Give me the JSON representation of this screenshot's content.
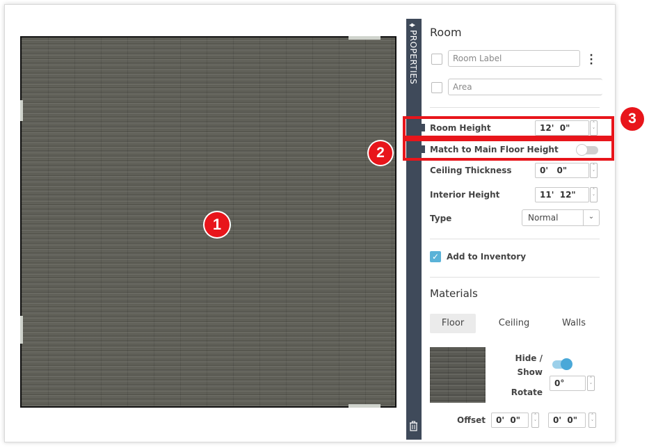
{
  "panel": {
    "section_title": "Room",
    "room_label_placeholder": "Room Label",
    "area_placeholder": "Area",
    "room_height_label": "Room Height",
    "room_height_value": "12'  0\"",
    "match_label": "Match to Main Floor Height",
    "match_toggle": "off",
    "ceiling_thickness_label": "Ceiling Thickness",
    "ceiling_thickness_value": "0'   0\"",
    "interior_height_label": "Interior Height",
    "interior_height_value": "11'  12\"",
    "type_label": "Type",
    "type_value": "Normal",
    "add_inventory_label": "Add to Inventory",
    "add_inventory_checked": true
  },
  "sidebar": {
    "label": "PROPERTIES"
  },
  "materials": {
    "title": "Materials",
    "tabs": [
      "Floor",
      "Ceiling",
      "Walls"
    ],
    "active_tab": "Floor",
    "hide_show_label_1": "Hide /",
    "hide_show_label_2": "Show",
    "hide_show_toggle": "on",
    "rotate_label": "Rotate",
    "rotate_value": "0°",
    "offset_label": "Offset",
    "offset_x": "0'  0\"",
    "offset_y": "0'  0\""
  },
  "annotations": [
    "1",
    "2",
    "3"
  ],
  "colors": {
    "highlight": "#e8151b",
    "accent": "#5ab2d8",
    "sidebar": "#3f4a5a"
  },
  "icons": [
    "collapse-arrows-icon",
    "trash-icon",
    "kebab-menu-icon",
    "spinner-icon",
    "chevron-down-icon",
    "checkmark-icon"
  ]
}
